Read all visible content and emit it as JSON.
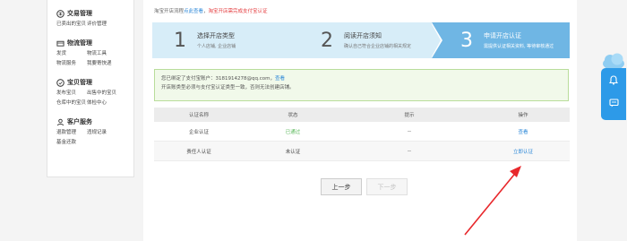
{
  "sidebar": {
    "sections": [
      {
        "title": "交易管理",
        "icon": "trade-icon",
        "links": [
          "已卖出的宝贝",
          "评价管理"
        ]
      },
      {
        "title": "物流管理",
        "icon": "logistics-icon",
        "links": [
          "发货",
          "物流工具",
          "物流服务",
          "我要寄快递"
        ]
      },
      {
        "title": "宝贝管理",
        "icon": "goods-icon",
        "links": [
          "发布宝贝",
          "出售中的宝贝",
          "仓库中的宝贝",
          "体检中心"
        ]
      },
      {
        "title": "客户服务",
        "icon": "service-icon",
        "links": [
          "退款管理",
          "违规记录",
          "基金还款"
        ]
      }
    ]
  },
  "notice": {
    "prefix": "淘宝开店流程",
    "link1": "点此查看",
    "sep": "，",
    "red": "淘宝开店需完成支付宝认证"
  },
  "steps": [
    {
      "num": "1",
      "title": "选择开店类型",
      "desc": "个人店铺, 企业店铺"
    },
    {
      "num": "2",
      "title": "阅读开店须知",
      "desc": "确认自己符合企业店铺的相关规定"
    },
    {
      "num": "3",
      "title": "申请开店认证",
      "desc": "需提供认证相关资料, 等待审核通过"
    }
  ],
  "bind_box": {
    "line1_prefix": "您已绑定了支付宝账户：3181914278@qq.com，",
    "line1_link": "查看",
    "line2": "开店账类型必须与支付宝认证类型一致，否则无法创建店铺。"
  },
  "table": {
    "headers": [
      "认证名称",
      "状态",
      "提示",
      "操作"
    ],
    "rows": [
      {
        "name": "企业认证",
        "status": "已通过",
        "hint": "--",
        "action": "查看"
      },
      {
        "name": "责任人认证",
        "status": "未认证",
        "hint": "--",
        "action": "立即认证"
      }
    ]
  },
  "buttons": {
    "prev": "上一步",
    "next": "下一步"
  },
  "colors": {
    "accent": "#2b87d8",
    "success": "#5cb85c",
    "warning": "#e4393c",
    "step_active": "#6fb6e4",
    "step_inactive": "#d7edf8"
  },
  "float_widget": {
    "icons": [
      "bell-icon",
      "message-icon"
    ]
  }
}
